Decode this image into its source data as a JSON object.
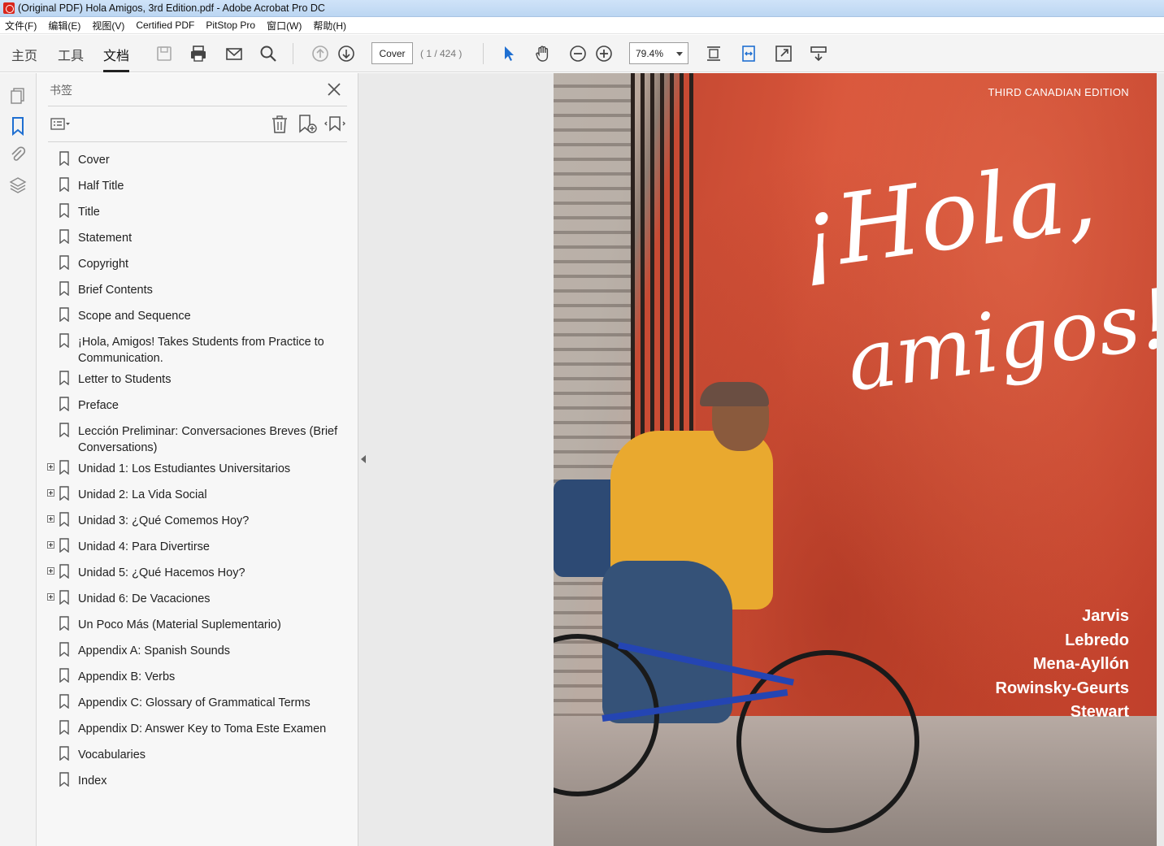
{
  "window": {
    "title": "(Original PDF) Hola Amigos, 3rd Edition.pdf - Adobe Acrobat Pro DC"
  },
  "menu": [
    "文件(F)",
    "编辑(E)",
    "视图(V)",
    "Certified PDF",
    "PitStop Pro",
    "窗口(W)",
    "帮助(H)"
  ],
  "toolbar": {
    "tabs": [
      "主页",
      "工具",
      "文档"
    ],
    "active_tab": "文档",
    "page_label": "Cover",
    "page_count": "( 1 / 424 )",
    "zoom": "79.4%"
  },
  "bookmarks_panel": {
    "title": "书签",
    "items": [
      {
        "label": "Cover",
        "expandable": false
      },
      {
        "label": "Half Title",
        "expandable": false
      },
      {
        "label": "Title",
        "expandable": false
      },
      {
        "label": "Statement",
        "expandable": false
      },
      {
        "label": "Copyright",
        "expandable": false
      },
      {
        "label": "Brief Contents",
        "expandable": false
      },
      {
        "label": "Scope and Sequence",
        "expandable": false
      },
      {
        "label": "¡Hola, Amigos! Takes Students from Practice to Communication.",
        "expandable": false
      },
      {
        "label": "Letter to Students",
        "expandable": false
      },
      {
        "label": "Preface",
        "expandable": false
      },
      {
        "label": "Lección Preliminar: Conversaciones Breves (Brief Conversations)",
        "expandable": false
      },
      {
        "label": "Unidad 1: Los Estudiantes Universitarios",
        "expandable": true
      },
      {
        "label": "Unidad 2: La Vida Social",
        "expandable": true
      },
      {
        "label": "Unidad 3: ¿Qué Comemos Hoy?",
        "expandable": true
      },
      {
        "label": "Unidad 4: Para Divertirse",
        "expandable": true
      },
      {
        "label": "Unidad 5: ¿Qué Hacemos Hoy?",
        "expandable": true
      },
      {
        "label": "Unidad 6: De Vacaciones",
        "expandable": true
      },
      {
        "label": "Un Poco Más (Material Suplementario)",
        "expandable": false
      },
      {
        "label": "Appendix A: Spanish Sounds",
        "expandable": false
      },
      {
        "label": "Appendix B: Verbs",
        "expandable": false
      },
      {
        "label": "Appendix C: Glossary of Grammatical Terms",
        "expandable": false
      },
      {
        "label": "Appendix D: Answer Key to Toma Este Examen",
        "expandable": false
      },
      {
        "label": "Vocabularies",
        "expandable": false
      },
      {
        "label": "Index",
        "expandable": false
      }
    ]
  },
  "cover": {
    "edition": "THIRD CANADIAN EDITION",
    "title_line1": "¡Hola,",
    "title_line2": "amigos!",
    "authors": [
      "Jarvis",
      "Lebredo",
      "Mena-Ayllón",
      "Rowinsky-Geurts",
      "Stewart"
    ]
  },
  "icons": {
    "rail": [
      "pages-icon",
      "bookmark-icon",
      "attachment-icon",
      "layers-icon"
    ],
    "accent": "#1f6fd1"
  }
}
